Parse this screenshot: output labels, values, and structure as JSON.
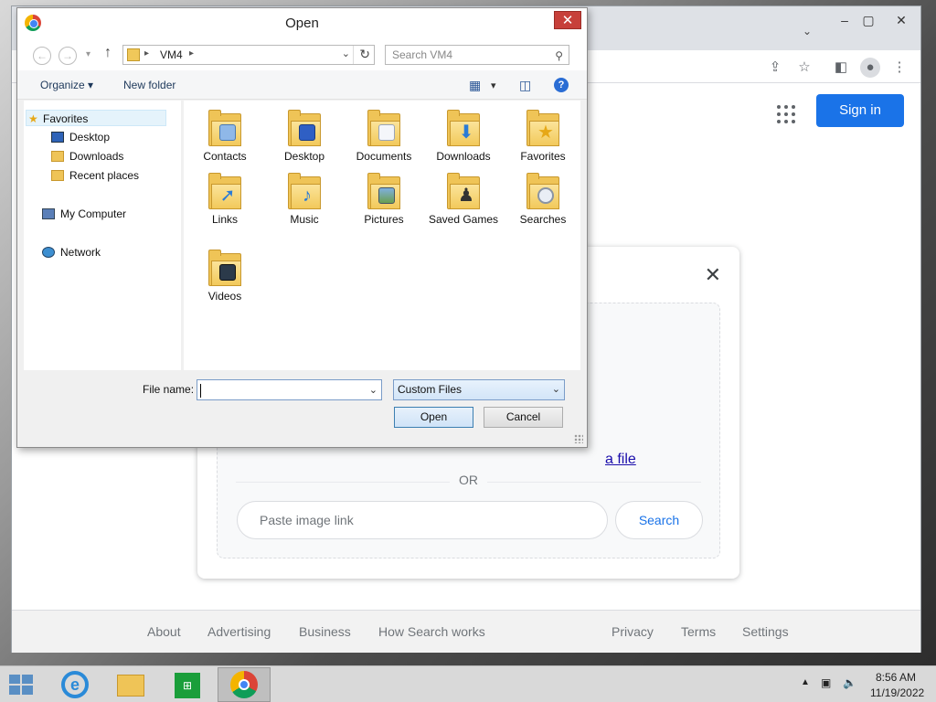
{
  "dialog": {
    "title": "Open",
    "address_path": "VM4",
    "search_placeholder": "Search VM4",
    "organize_label": "Organize ▾",
    "new_folder_label": "New folder",
    "nav_items": [
      {
        "label": "Favorites"
      },
      {
        "label": "Desktop"
      },
      {
        "label": "Downloads"
      },
      {
        "label": "Recent places"
      },
      {
        "label": "My Computer"
      },
      {
        "label": "Network"
      }
    ],
    "files": [
      {
        "label": "Contacts",
        "icon": "contacts-folder-icon"
      },
      {
        "label": "Desktop",
        "icon": "desktop-folder-icon"
      },
      {
        "label": "Documents",
        "icon": "documents-folder-icon"
      },
      {
        "label": "Downloads",
        "icon": "downloads-folder-icon"
      },
      {
        "label": "Favorites",
        "icon": "favorites-folder-icon"
      },
      {
        "label": "Links",
        "icon": "links-folder-icon"
      },
      {
        "label": "Music",
        "icon": "music-folder-icon"
      },
      {
        "label": "Pictures",
        "icon": "pictures-folder-icon"
      },
      {
        "label": "Saved Games",
        "icon": "saved-games-folder-icon"
      },
      {
        "label": "Searches",
        "icon": "searches-folder-icon"
      },
      {
        "label": "Videos",
        "icon": "videos-folder-icon"
      }
    ],
    "file_name_label": "File name:",
    "file_name_value": "",
    "file_type_value": "Custom Files",
    "open_label": "Open",
    "cancel_label": "Cancel"
  },
  "browser": {
    "sign_in_label": "Sign in",
    "upload_link_partial": "a file",
    "or_label": "OR",
    "paste_placeholder": "Paste image link",
    "search_label": "Search",
    "footer_links": [
      "About",
      "Advertising",
      "Business",
      "How Search works",
      "Privacy",
      "Terms",
      "Settings"
    ]
  },
  "taskbar": {
    "time": "8:56 AM",
    "date": "11/19/2022"
  }
}
